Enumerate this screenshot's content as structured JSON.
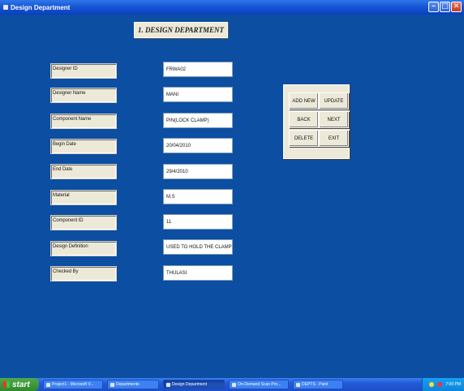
{
  "window": {
    "title": "Design Department"
  },
  "heading": "1. DESIGN DEPARTMENT",
  "fields": [
    {
      "label": "Designer ID",
      "value": "FRWA02"
    },
    {
      "label": "Designer Name",
      "value": "MANI"
    },
    {
      "label": "Component Name",
      "value": "PIN(LOCK CLAMP)"
    },
    {
      "label": "Begin Date",
      "value": "20/04/2010"
    },
    {
      "label": "End Date",
      "value": "29/4/2010"
    },
    {
      "label": "Material",
      "value": "M.S"
    },
    {
      "label": "Component ID",
      "value": "11"
    },
    {
      "label": "Design Definition",
      "value": "USED TO HOLD THE CLAMP"
    },
    {
      "label": "Checked By",
      "value": "THULASI"
    }
  ],
  "buttons": {
    "add_new": "ADD NEW",
    "update": "UPDATE",
    "back": "BACK",
    "next": "NEXT",
    "delete": "DELETE",
    "exit": "EXIT"
  },
  "taskbar": {
    "start": "start",
    "tasks": [
      "Project1 - Microsoft V...",
      "Departments",
      "Design Department",
      "On-Demand Scan Pro...",
      "DEPTS - Paint"
    ],
    "clock": "7:00 PM"
  },
  "icons": {
    "window": "app-icon",
    "minimize": "minimize-icon",
    "maximize": "maximize-icon",
    "close": "close-icon"
  }
}
